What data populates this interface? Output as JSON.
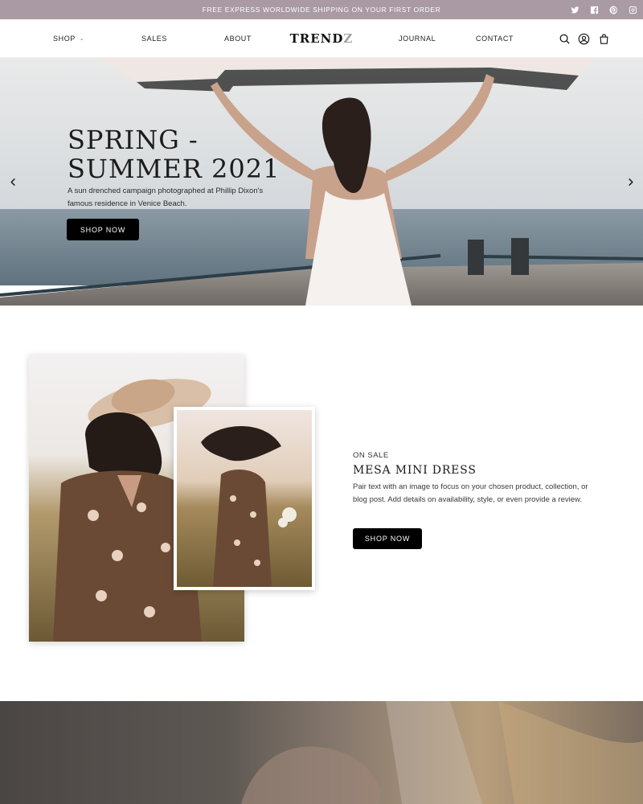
{
  "announcement": {
    "text": "FREE EXPRESS WORLDWIDE SHIPPING ON YOUR FIRST ORDER"
  },
  "social": [
    "twitter-icon",
    "facebook-icon",
    "pinterest-icon",
    "instagram-icon"
  ],
  "nav": {
    "shop": "SHOP",
    "sales": "SALES",
    "about": "ABOUT",
    "logo_main": "TREND",
    "logo_accent": "Z",
    "journal": "JOURNAL",
    "contact": "CONTACT"
  },
  "header_icons": [
    "search-icon",
    "account-icon",
    "cart-icon"
  ],
  "hero": {
    "title_line1": "SPRING -",
    "title_line2": "SUMMER 2021",
    "subtitle": "A sun drenched campaign photographed at Phillip Dixon's famous residence in Venice Beach.",
    "button": "SHOP NOW"
  },
  "feature": {
    "eyebrow": "ON SALE",
    "title": "MESA MINI DRESS",
    "description": "Pair text with an image to focus on your chosen product, collection, or blog post. Add details on availability, style, or even provide a review.",
    "button": "SHOP NOW"
  },
  "colors": {
    "announcement_bg": "#a99aa3",
    "button_bg": "#000000",
    "accent_logo": "#a0a0a0"
  }
}
